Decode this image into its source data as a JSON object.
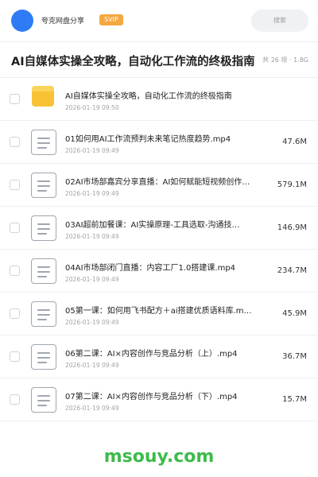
{
  "header": {
    "app_name": "夸克网盘分享",
    "badge": "SVIP",
    "search_placeholder": "搜索",
    "accent_color": "#2f7bf5",
    "badge_color": "#f6a740"
  },
  "folder": {
    "title": "AI自媒体实操全攻略，自动化工作流的终极指南",
    "meta": "共 26 项 · 1.8G"
  },
  "items": [
    {
      "type": "folder",
      "icon": "folder-icon",
      "name": "AI自媒体实操全攻略，自动化工作流的终极指南",
      "date": "2026-01-19 09:50",
      "size": ""
    },
    {
      "type": "file",
      "icon": "file-video-icon",
      "name": "01如何用AI工作流预判未来笔记热度趋势.mp4",
      "date": "2026-01-19 09:49",
      "size": "47.6M"
    },
    {
      "type": "file",
      "icon": "file-video-icon",
      "name": "02AI市场部嘉宾分享直播：AI如何赋能短视频创作…",
      "date": "2026-01-19 09:49",
      "size": "579.1M"
    },
    {
      "type": "file",
      "icon": "file-video-icon",
      "name": "03AI超前加餐课：AI实操原理-工具选取-沟通技…",
      "date": "2026-01-19 09:49",
      "size": "146.9M"
    },
    {
      "type": "file",
      "icon": "file-video-icon",
      "name": "04AI市场部闭门直播：内容工厂1.0搭建课.mp4",
      "date": "2026-01-19 09:49",
      "size": "234.7M"
    },
    {
      "type": "file",
      "icon": "file-video-icon",
      "name": "05第一课：如何用飞书配方＋ai搭建优质语料库.m…",
      "date": "2026-01-19 09:49",
      "size": "45.9M"
    },
    {
      "type": "file",
      "icon": "file-video-icon",
      "name": "06第二课：AI×内容创作与竞品分析（上）.mp4",
      "date": "2026-01-19 09:49",
      "size": "36.7M"
    },
    {
      "type": "file",
      "icon": "file-video-icon",
      "name": "07第二课：AI×内容创作与竞品分析（下）.mp4",
      "date": "2026-01-19 09:49",
      "size": "15.7M"
    }
  ],
  "watermark": "msouy.com"
}
